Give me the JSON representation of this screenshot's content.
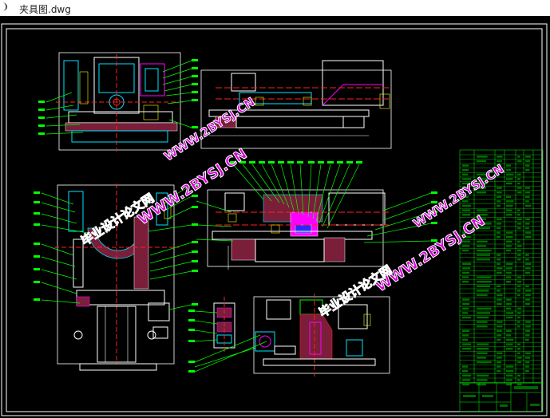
{
  "window": {
    "title": "夹具图.dwg",
    "nav_glyph": "❩"
  },
  "watermarks": {
    "url_text": "WWW.2BYSJ.CN",
    "cn_text": "毕业设计论文网"
  },
  "colors": {
    "background": "#000000",
    "frame": "#ffffff",
    "cyan": "#00e5ff",
    "green": "#00ff00",
    "magenta": "#ff00ff",
    "red": "#ff2020",
    "yellow": "#ffff00",
    "watermark_fill": "#d400d4",
    "watermark_stroke": "#ffffff"
  }
}
